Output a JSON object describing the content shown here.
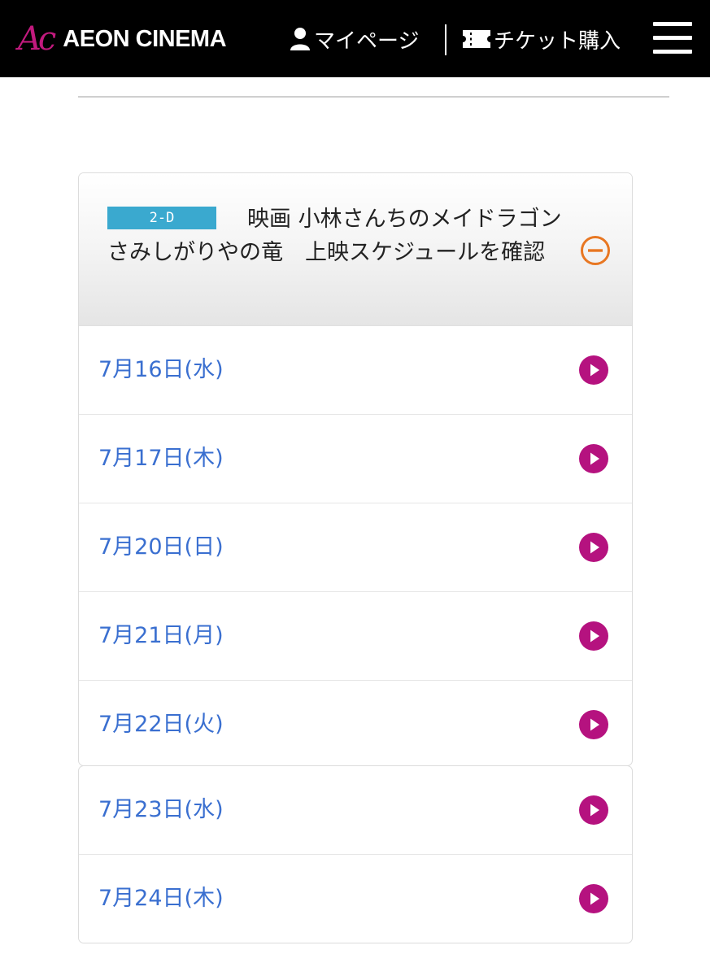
{
  "header": {
    "logo_mark": "Ac",
    "logo_text": "AEON CINEMA",
    "mypage_label": "マイページ",
    "ticket_label": "チケット購入",
    "colors": {
      "background": "#000000",
      "logo_accent": "#c21a7e"
    }
  },
  "schedule": {
    "format_badge": "2-D",
    "movie_title": "映画 小林さんちのメイドラゴン さみしがりやの竜　上映スケジュールを確認",
    "collapse_icon": "minus-circle-icon",
    "dates": [
      {
        "label": "7月16日(水)"
      },
      {
        "label": "7月17日(木)"
      },
      {
        "label": "7月20日(日)"
      },
      {
        "label": "7月21日(月)"
      },
      {
        "label": "7月22日(火)"
      }
    ],
    "more_dates": [
      {
        "label": "7月23日(水)"
      },
      {
        "label": "7月24日(木)"
      }
    ],
    "colors": {
      "badge": "#3aa9cf",
      "date_text": "#3a6fd0",
      "play_icon": "#b5127f",
      "collapse_icon": "#e87722"
    }
  }
}
